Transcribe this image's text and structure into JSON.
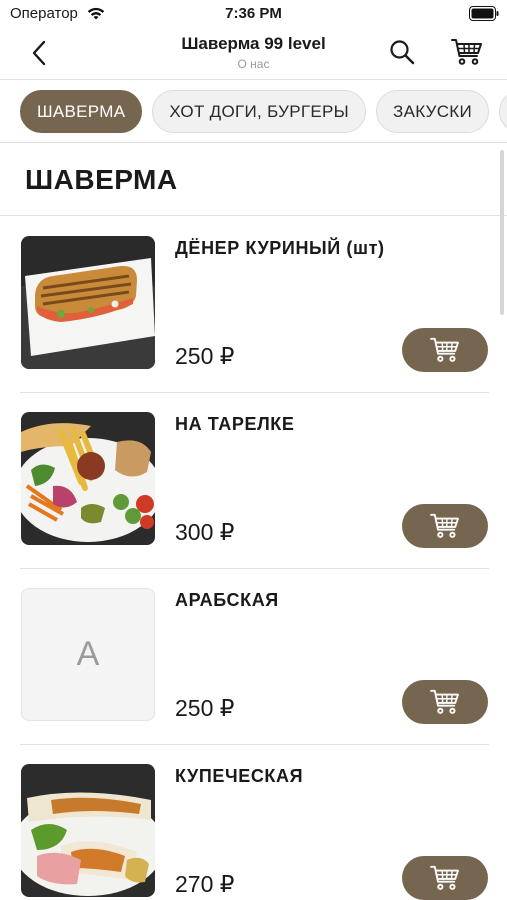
{
  "status_bar": {
    "carrier": "Оператор",
    "time": "7:36 PM"
  },
  "nav": {
    "title": "Шаверма 99 level",
    "subtitle": "О нас"
  },
  "categories": [
    {
      "label": "ШАВЕРМА",
      "active": true
    },
    {
      "label": "ХОТ ДОГИ, БУРГЕРЫ",
      "active": false
    },
    {
      "label": "ЗАКУСКИ",
      "active": false
    },
    {
      "label": "Д",
      "active": false
    }
  ],
  "section": {
    "title": "ШАВЕРМА"
  },
  "products": [
    {
      "name": "ДЁНЕР КУРИНЫЙ (шт)",
      "price": "250 ₽",
      "image": "photo-doner"
    },
    {
      "name": "НА ТАРЕЛКЕ",
      "price": "300 ₽",
      "image": "photo-plate"
    },
    {
      "name": "АРАБСКАЯ",
      "price": "250 ₽",
      "image": "placeholder",
      "placeholder_letter": "A"
    },
    {
      "name": "КУПЕЧЕСКАЯ",
      "price": "270 ₽",
      "image": "photo-wraps"
    }
  ],
  "colors": {
    "accent": "#76664f",
    "divider": "#e2e2e2",
    "chip_bg": "#f1f1f1"
  }
}
